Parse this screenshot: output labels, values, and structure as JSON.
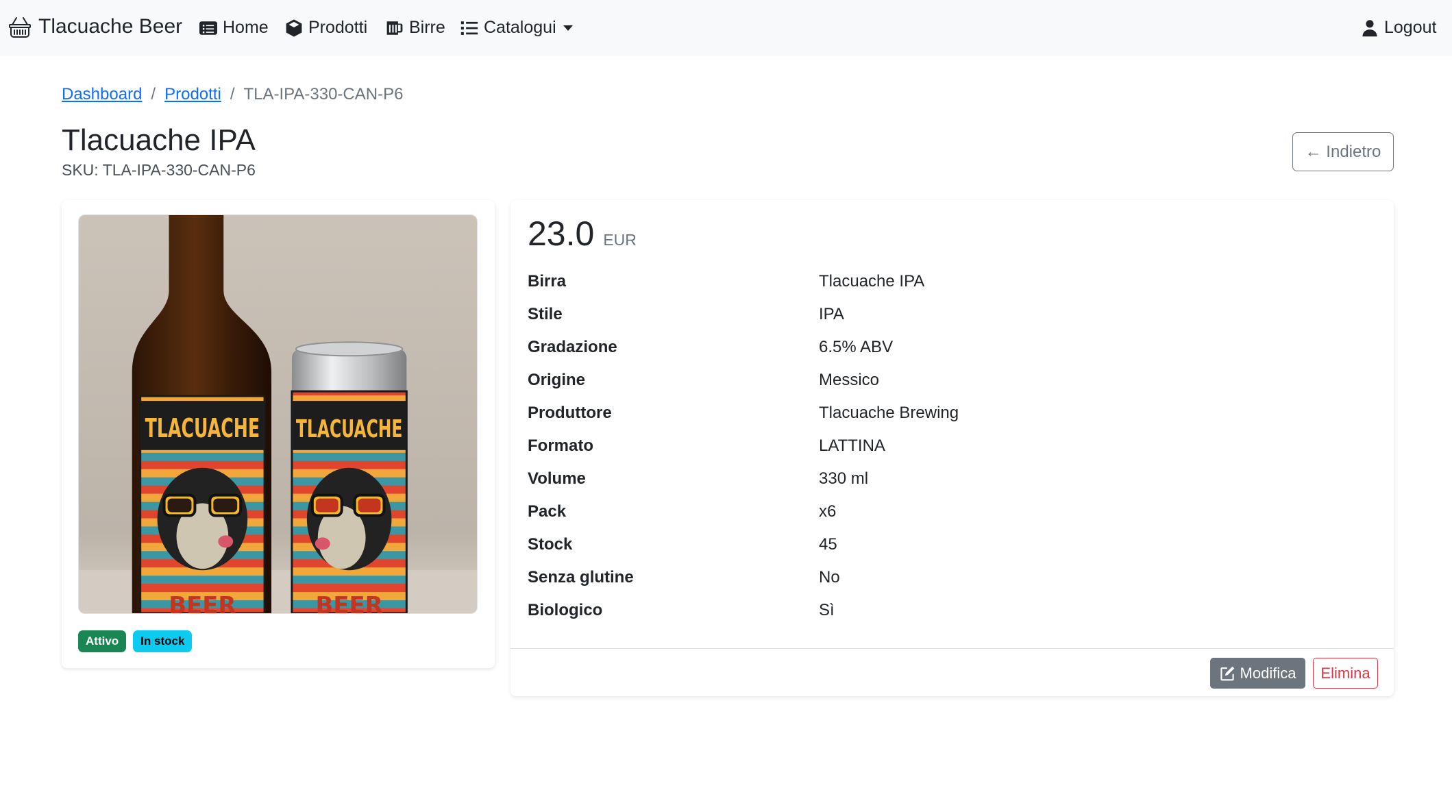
{
  "navbar": {
    "brand": "Tlacuache Beer",
    "brand_icon": "basket-icon",
    "items": [
      {
        "label": "Home",
        "icon": "card-list-icon"
      },
      {
        "label": "Prodotti",
        "icon": "box-icon"
      },
      {
        "label": "Birre",
        "icon": "beer-mug-icon"
      },
      {
        "label": "Catalogui",
        "icon": "list-icon"
      }
    ],
    "logout": "Logout"
  },
  "breadcrumb": {
    "dashboard": "Dashboard",
    "products": "Prodotti",
    "separator": "/",
    "current": "TLA-IPA-330-CAN-P6"
  },
  "page": {
    "title": "Tlacuache IPA",
    "sku": "SKU: TLA-IPA-330-CAN-P6",
    "back_button": "← Indietro"
  },
  "image_card": {
    "label_text": "TLACUACHE",
    "label_text_bottom": "BEER",
    "badges": {
      "active": "Attivo",
      "stock": "In stock"
    }
  },
  "details": {
    "price": "23.0",
    "currency": "EUR",
    "rows": [
      {
        "label": "Birra",
        "value": "Tlacuache IPA"
      },
      {
        "label": "Stile",
        "value": "IPA"
      },
      {
        "label": "Gradazione",
        "value": "6.5% ABV"
      },
      {
        "label": "Origine",
        "value": "Messico"
      },
      {
        "label": "Produttore",
        "value": "Tlacuache Brewing"
      },
      {
        "label": "Formato",
        "value": "LATTINA"
      },
      {
        "label": "Volume",
        "value": "330 ml"
      },
      {
        "label": "Pack",
        "value": "x6"
      },
      {
        "label": "Stock",
        "value": "45"
      },
      {
        "label": "Senza glutine",
        "value": "No"
      },
      {
        "label": "Biologico",
        "value": "Sì"
      }
    ],
    "edit_button": "Modifica",
    "delete_button": "Elimina"
  },
  "colors": {
    "navbar_bg": "#f8f9fa",
    "link": "#0d6efd",
    "secondary": "#6c757d",
    "success": "#198754",
    "info": "#0dcaf0",
    "danger": "#dc3545"
  }
}
